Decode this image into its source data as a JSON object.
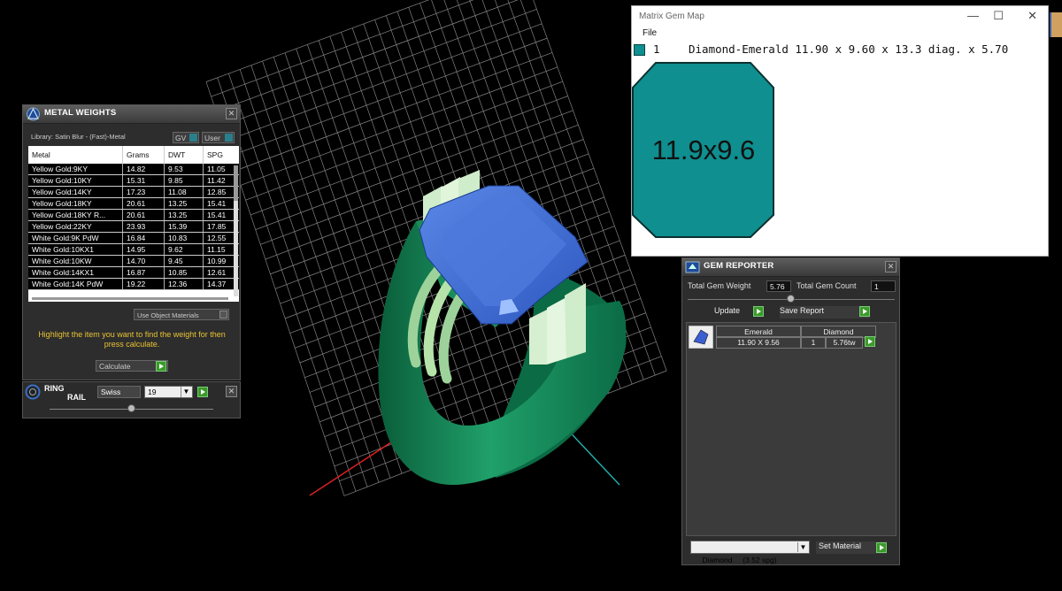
{
  "metal_weights": {
    "title": "METAL WEIGHTS",
    "library": "Library: Satin Blur - (Fast)-Metal",
    "gv_label": "GV",
    "user_label": "User",
    "columns": [
      "Metal",
      "Grams",
      "DWT",
      "SPG"
    ],
    "rows": [
      [
        "Yellow Gold:9KY",
        "14.82",
        "9.53",
        "11.05"
      ],
      [
        "Yellow Gold:10KY",
        "15.31",
        "9.85",
        "11.42"
      ],
      [
        "Yellow Gold:14KY",
        "17.23",
        "11.08",
        "12.85"
      ],
      [
        "Yellow Gold:18KY",
        "20.61",
        "13.25",
        "15.41"
      ],
      [
        "Yellow Gold:18KY R...",
        "20.61",
        "13.25",
        "15.41"
      ],
      [
        "Yellow Gold:22KY",
        "23.93",
        "15.39",
        "17.85"
      ],
      [
        "White Gold:9K PdW",
        "16.84",
        "10.83",
        "12.55"
      ],
      [
        "White Gold:10KX1",
        "14.95",
        "9.62",
        "11.15"
      ],
      [
        "White Gold:10KW",
        "14.70",
        "9.45",
        "10.99"
      ],
      [
        "White Gold:14KX1",
        "16.87",
        "10.85",
        "12.61"
      ],
      [
        "White Gold:14K PdW",
        "19.22",
        "12.36",
        "14.37"
      ]
    ],
    "use_object_materials": "Use Object Materials",
    "hint": "Highlight the item you want to find the weight for then press calculate.",
    "calculate_label": "Calculate"
  },
  "ring_rail": {
    "title_line1": "RING",
    "title_line2": "RAIL",
    "standard": "Swiss",
    "size": "19"
  },
  "gem_map": {
    "window_title": "Matrix Gem Map",
    "menu_file": "File",
    "gem_index": "1",
    "gem_line": "Diamond-Emerald 11.90 x 9.60 x 13.3 diag. x 5.70",
    "gem_label": "11.9x9.6",
    "gem_color": "#0f8f8f"
  },
  "gem_reporter": {
    "title": "GEM REPORTER",
    "total_weight_label": "Total Gem Weight",
    "total_weight_value": "5.76",
    "total_count_label": "Total Gem Count",
    "total_count_value": "1",
    "update_label": "Update",
    "save_report_label": "Save Report",
    "col_cut": "Emerald",
    "col_material": "Diamond",
    "size_value": "11.90 X 9.56",
    "count_value": "1",
    "weight_value": "5.76tw",
    "material_select": "Diamond     (3.52 spg)",
    "set_material_label": "Set Material"
  }
}
